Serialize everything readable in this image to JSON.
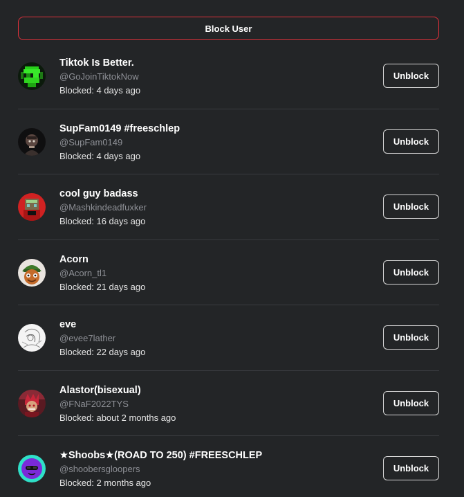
{
  "header": {
    "block_user_label": "Block User"
  },
  "blocked_users": [
    {
      "display_name": "Tiktok Is Better.",
      "handle": "@GoJoinTiktokNow",
      "blocked": "Blocked: 4 days ago",
      "action_label": "Unblock",
      "avatar": "green-glitch-avatar"
    },
    {
      "display_name": "SupFam0149 #freeschlep",
      "handle": "@SupFam0149",
      "blocked": "Blocked: 4 days ago",
      "action_label": "Unblock",
      "avatar": "dark-character-avatar"
    },
    {
      "display_name": "cool guy badass",
      "handle": "@Mashkindeadfuxker",
      "blocked": "Blocked: 16 days ago",
      "action_label": "Unblock",
      "avatar": "red-pixel-avatar"
    },
    {
      "display_name": "Acorn",
      "handle": "@Acorn_tl1",
      "blocked": "Blocked: 21 days ago",
      "action_label": "Unblock",
      "avatar": "acorn-character-avatar"
    },
    {
      "display_name": "eve",
      "handle": "@evee7lather",
      "blocked": "Blocked: 22 days ago",
      "action_label": "Unblock",
      "avatar": "sketch-avatar"
    },
    {
      "display_name": "Alastor(bisexual)",
      "handle": "@FNaF2022TYS",
      "blocked": "Blocked: about 2 months ago",
      "action_label": "Unblock",
      "avatar": "red-character-avatar"
    },
    {
      "display_name": "★Shoobs★(ROAD TO 250) #FREESCHLEP",
      "handle": "@shoobersgloopers",
      "blocked": "Blocked: 2 months ago",
      "action_label": "Unblock",
      "avatar": "purple-cyan-avatar"
    }
  ]
}
